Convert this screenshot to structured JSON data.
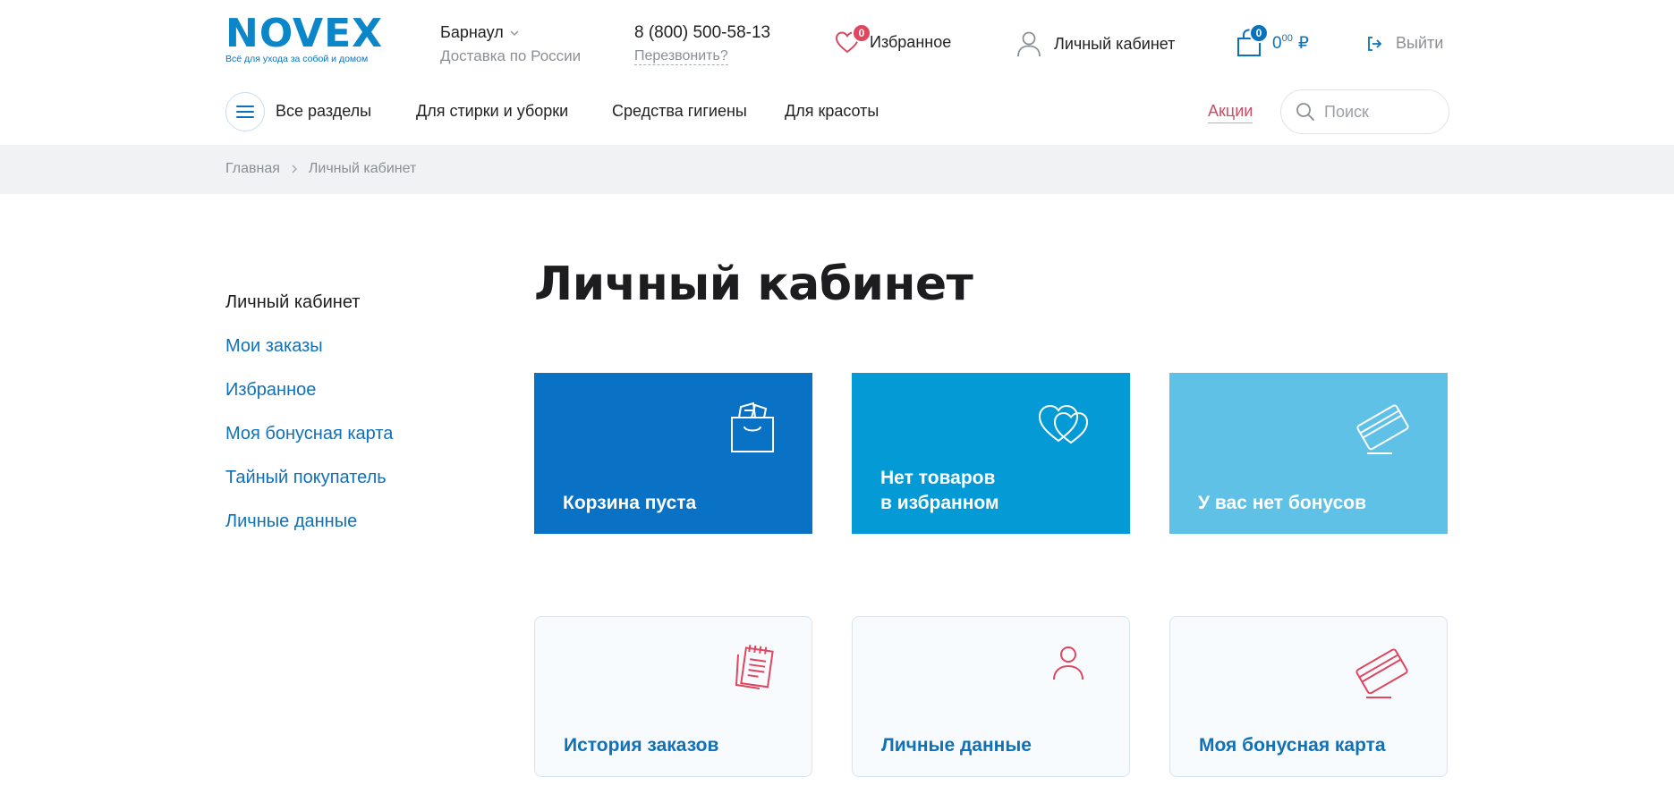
{
  "brand": {
    "logo_text": "NOVEX",
    "tagline": "Всё для ухода за собой и домом",
    "accent": "#0a72bd",
    "promo_color": "#d44b61"
  },
  "header": {
    "city": "Барнаул",
    "delivery": "Доставка по России",
    "phone": "8 (800) 500-58-13",
    "callback": "Перезвонить?",
    "favorites_label": "Избранное",
    "favorites_count": "0",
    "account_label": "Личный кабинет",
    "cart_count": "0",
    "cart_sum_main": "0",
    "cart_sum_kop": "00",
    "cart_currency": "₽",
    "logout_label": "Выйти"
  },
  "nav": {
    "all_sections": "Все разделы",
    "items": [
      "Для стирки и уборки",
      "Средства гигиены",
      "Для красоты"
    ],
    "promo": "Акции",
    "search_placeholder": "Поиск"
  },
  "breadcrumb": {
    "home": "Главная",
    "current": "Личный кабинет"
  },
  "sidebar": {
    "items": [
      {
        "label": "Личный кабинет",
        "active": true
      },
      {
        "label": "Мои заказы",
        "active": false
      },
      {
        "label": "Избранное",
        "active": false
      },
      {
        "label": "Моя бонусная карта",
        "active": false
      },
      {
        "label": "Тайный покупатель",
        "active": false
      },
      {
        "label": "Личные данные",
        "active": false
      }
    ]
  },
  "main": {
    "title": "Личный кабинет",
    "tiles": [
      {
        "line1": "Корзина пуста",
        "line2": "",
        "icon": "shopping-bag-icon",
        "color": "#0a72c4"
      },
      {
        "line1": "Нет товаров",
        "line2": "в избранном",
        "icon": "hearts-icon",
        "color": "#039ad5"
      },
      {
        "line1": "У вас нет бонусов",
        "line2": "",
        "icon": "bonus-card-icon",
        "color": "#5fc1e6"
      },
      {
        "line1": "История заказов",
        "line2": "",
        "icon": "notepad-icon",
        "color": "#e0465e"
      },
      {
        "line1": "Личные данные",
        "line2": "",
        "icon": "person-icon",
        "color": "#e0465e"
      },
      {
        "line1": "Моя бонусная карта",
        "line2": "",
        "icon": "bonus-card-icon",
        "color": "#e0465e"
      }
    ]
  }
}
